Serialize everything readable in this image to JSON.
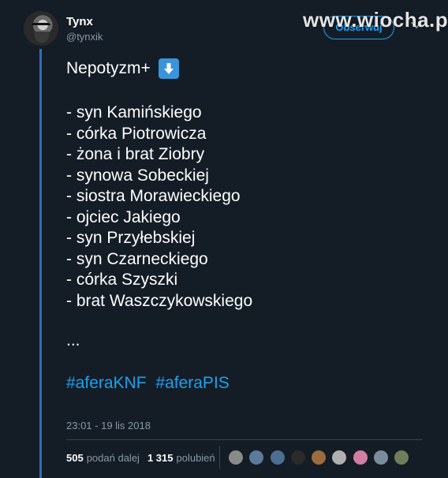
{
  "user": {
    "display_name": "Tynx",
    "handle": "@tynxik"
  },
  "follow_button": {
    "label": "Obserwuj"
  },
  "watermark": {
    "text": "www.wiocha.pl"
  },
  "tweet": {
    "title": "Nepotyzm+",
    "title_icon": "down-arrow-emoji",
    "items": [
      "- syn Kamińskiego",
      "- córka Piotrowicza",
      "- żona i brat Ziobry",
      "- synowa Sobeckiej",
      "- siostra Morawieckiego",
      "- ojciec Jakiego",
      "- syn Przyłebskiej",
      "- syn Czarneckiego",
      "- córka Szyszki",
      "- brat Waszczykowskiego"
    ],
    "ellipsis": "...",
    "hashtags": [
      "#aferaKNF",
      "#aferaPIS"
    ],
    "timestamp": "23:01 - 19 lis 2018"
  },
  "stats": {
    "retweets_count": "505",
    "retweets_label": "podań dalej",
    "likes_count": "1 315",
    "likes_label": "polubień"
  },
  "colors": {
    "background": "#141d26",
    "accent": "#1da1f2",
    "thread_line": "#2f6fb3",
    "muted": "#8899a6"
  },
  "liker_avatars": [
    {
      "color": "#8a8a8a"
    },
    {
      "color": "#5c7a99"
    },
    {
      "color": "#4c6e91"
    },
    {
      "color": "#2b2b2b"
    },
    {
      "color": "#9c6b3f"
    },
    {
      "color": "#b0b0b0"
    },
    {
      "color": "#d27ea3"
    },
    {
      "color": "#7a8d9c"
    },
    {
      "color": "#6f7e5a"
    }
  ]
}
